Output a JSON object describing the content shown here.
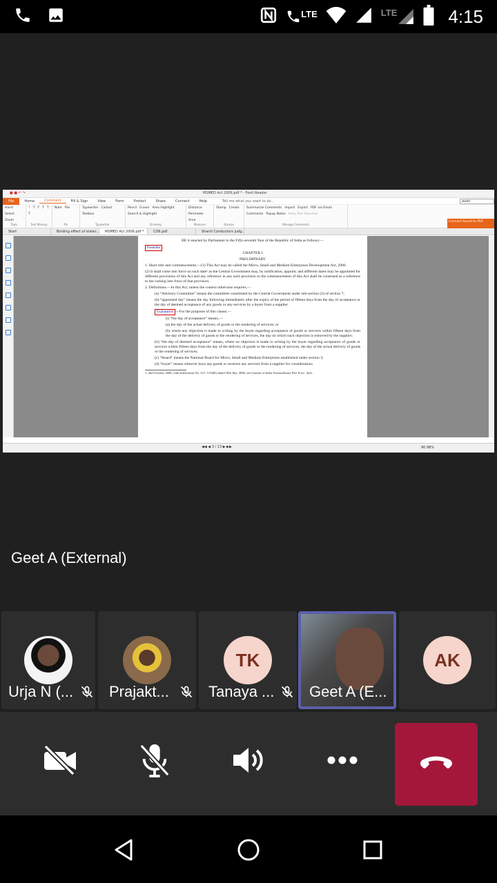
{
  "status_bar": {
    "time": "4:15",
    "lte1": "LTE",
    "lte2": "LTE"
  },
  "shared_screen": {
    "window_title": "MSMED Act 2006.pdf * - Foxit Reader",
    "menu": [
      "File",
      "Home",
      "Comment",
      "Fill & Sign",
      "View",
      "Form",
      "Protect",
      "Share",
      "Connect",
      "Help"
    ],
    "tell_me": "Tell me what you want to do...",
    "search_value": "avair",
    "ribbon_groups": [
      {
        "label": "Tools",
        "items": [
          "Hand",
          "Select",
          "Zoom"
        ]
      },
      {
        "label": "Text Markup",
        "items": [
          "T",
          "T",
          "T",
          "T",
          "T",
          "T"
        ]
      },
      {
        "label": "Pin",
        "items": [
          "Note",
          "File"
        ]
      },
      {
        "label": "Typewriter",
        "items": [
          "Typewriter",
          "Callout",
          "Textbox"
        ]
      },
      {
        "label": "Drawing",
        "items": [
          "Pencil",
          "Eraser",
          "Area Highlight",
          "Search & Highlight"
        ]
      },
      {
        "label": "Measure",
        "items": [
          "Distance",
          "Perimeter",
          "Area"
        ]
      },
      {
        "label": "Stamps",
        "items": [
          "Stamp",
          "Create"
        ]
      },
      {
        "label": "Manage Comments",
        "items": [
          "Summarize Comments",
          "Import",
          "Export",
          "PDF via Email",
          "Comments",
          "Popup Notes",
          "Keep Tool Selected"
        ]
      }
    ],
    "connect_badge": "Connect Saved to PDF",
    "tabs": [
      "Start",
      "Binding effect of stater...",
      "MSMED Act 2006.pdf *",
      "CO6.pdf",
      "Shanti Conductors judg..."
    ],
    "document": {
      "top_line": "BE it enacted by Parliament in the Fifty-seventh Year of the Republic of India as follows:—",
      "preamble_box": "Preamble",
      "chapter": "CHAPTER I",
      "chapter_sub": "PRELIMINARY",
      "p1": "1. Short title and commencement.—(1) This Act may be called the Micro, Small and Medium Enterprises Development Act, 2006.",
      "p2": "(2) It shall come into force on such date¹ as the Central Government may, by notification, appoint; and different dates may be appointed for different provisions of this Act and any reference in any such provision to the commencement of this Act shall be construed as a reference to the coming into force of that provision.",
      "p3": "2. Definitions.—In this Act, unless the context otherwise requires,—",
      "p4": "(a) “Advisory Committee” means the committee constituted by the Central Government under sub-section (2) of section 7;",
      "p5": "(b) “appointed day” means the day following immediately after the expiry of the period of fifteen days from the day of acceptance or the day of deemed acceptance of any goods or any services by a buyer from a supplier.",
      "explanation_box": "Explanation",
      "p6": "—For the purposes of this clause,—",
      "p7": "(i) “the day of acceptance” means,—",
      "p8": "(a) the day of the actual delivery of goods or the rendering of services; or",
      "p9": "(b) where any objection is made in writing by the buyer regarding acceptance of goods or services within fifteen days from the day of the delivery of goods or the rendering of services, the day on which such objection is removed by the supplier;",
      "p10": "(ii) “the day of deemed acceptance” means, where no objection is made in writing by the buyer regarding acceptance of goods or services within fifteen days from the day of the delivery of goods or the rendering of services, the day of the actual delivery of goods or the rendering of services;",
      "p11": "(c) “Board” means the National Board for Micro, Small and Medium Enterprises established under section 3;",
      "p12": "(d) “buyer” means whoever buys any goods or receives any services from a supplier for consideration;",
      "footnote": "1. 2nd October, 2006, vide notification No. S.O. 1134(E) dated 18th July, 2006, see Gazette of India, Extraordinary Part II sec. 3(ii)."
    },
    "page_indicator": "3 / 13",
    "zoom": "90.98%"
  },
  "presenter_name": "Geet A (External)",
  "participants": [
    {
      "name": "Urja N (...",
      "type": "photo"
    },
    {
      "name": "Prajakt...",
      "type": "photo"
    },
    {
      "name": "Tanaya ...",
      "initials": "TK"
    },
    {
      "name": "Geet A (E...",
      "type": "video"
    },
    {
      "initials": "AK"
    }
  ]
}
